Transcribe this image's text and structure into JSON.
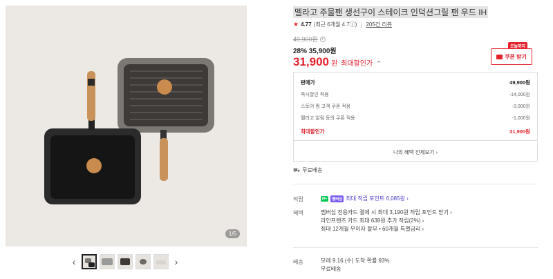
{
  "gallery": {
    "page_counter": "1/5",
    "prev_arrow": "‹",
    "next_arrow": "›",
    "thumbnails": [
      "thumb-1",
      "thumb-2",
      "thumb-3",
      "thumb-4",
      "thumb-5"
    ]
  },
  "product": {
    "title": "멜라고 주물팬 생선구이 스테이크 인덕션그릴 팬 우드 IH",
    "rating": "4.77",
    "rating_detail": "(최근 6개월 4.7ⓘ)",
    "review_count": "205건 리뷰",
    "original_price": "49,900원",
    "discount_line": "28% 35,900원",
    "best_price": "31,900",
    "best_price_unit": "원",
    "best_price_label": "최대할인가"
  },
  "coupon": {
    "today_badge": "오늘까지",
    "button_label": "쿠폰 받기"
  },
  "breakdown": {
    "header_label": "판매가",
    "header_value": "49,900원",
    "rows": [
      {
        "label": "즉시할인 적용",
        "value": "-14,000원"
      },
      {
        "label": "스토어 찜 고객 쿠폰 적용",
        "value": "-3,000원"
      },
      {
        "label": "멜라고 알림 동의 쿠폰 적용",
        "value": "-1,000원"
      }
    ],
    "total_label": "최대할인가",
    "total_value": "31,900원",
    "benefit_link": "나의 혜택 전체보기 ›"
  },
  "shipping_top": {
    "label": "무료배송"
  },
  "points": {
    "label": "적립",
    "badge_n": "N+",
    "badge_plus": "멤버십",
    "text": "최대 적립 포인트 6,085원 ›"
  },
  "benefits": {
    "label": "혜택",
    "lines": [
      "멤버십 전용카드 결제 시 최대 3,190원 적립 포인트 받기 ›",
      "라인프렌즈 카드 최대 638원 추가 적립(2%) ›",
      "최대 12개월 무이자 할부 • 60개월 특별금리 ›"
    ]
  },
  "delivery": {
    "label": "배송",
    "eta": "모레 9.16.(수) 도착 확률 93%",
    "fee": "무료배송"
  },
  "colors": {
    "accent_red": "#e3222e",
    "point_purple": "#4b3cc8",
    "npay_green": "#03c75a"
  }
}
